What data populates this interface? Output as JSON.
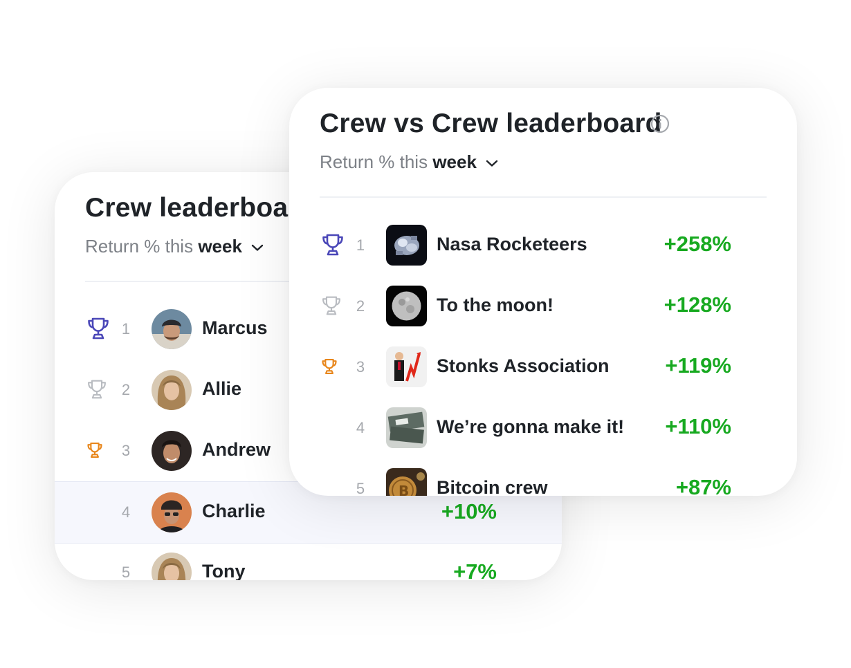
{
  "crew_board": {
    "title": "Crew leaderboard",
    "subtitle_prefix": "Return % this",
    "period": "week",
    "rows": [
      {
        "rank": "1",
        "name": "Marcus",
        "return": "",
        "trophy": "gold-trophy-icon"
      },
      {
        "rank": "2",
        "name": "Allie",
        "return": "",
        "trophy": "silver-trophy-icon"
      },
      {
        "rank": "3",
        "name": "Andrew",
        "return": "",
        "trophy": "bronze-trophy-icon"
      },
      {
        "rank": "4",
        "name": "Charlie",
        "return": "+10%",
        "trophy": ""
      },
      {
        "rank": "5",
        "name": "Tony",
        "return": "+7%",
        "trophy": ""
      }
    ]
  },
  "crew_vs_crew_board": {
    "title": "Crew vs Crew leaderboard",
    "info_icon": "info-icon",
    "subtitle_prefix": "Return % this",
    "period": "week",
    "rows": [
      {
        "rank": "1",
        "name": "Nasa Rocketeers",
        "return": "+258%",
        "trophy": "gold-trophy-icon"
      },
      {
        "rank": "2",
        "name": "To the moon!",
        "return": "+128%",
        "trophy": "silver-trophy-icon"
      },
      {
        "rank": "3",
        "name": "Stonks Association",
        "return": "+119%",
        "trophy": "bronze-trophy-icon"
      },
      {
        "rank": "4",
        "name": "We’re gonna make it!",
        "return": "+110%",
        "trophy": ""
      },
      {
        "rank": "5",
        "name": "Bitcoin crew",
        "return": "+87%",
        "trophy": ""
      }
    ]
  },
  "colors": {
    "gold_trophy": "#4a47b8",
    "silver_trophy": "#b9bcc1",
    "bronze_trophy": "#e8861b",
    "positive_return": "#17a920",
    "highlight_row": "#f6f7fd"
  }
}
